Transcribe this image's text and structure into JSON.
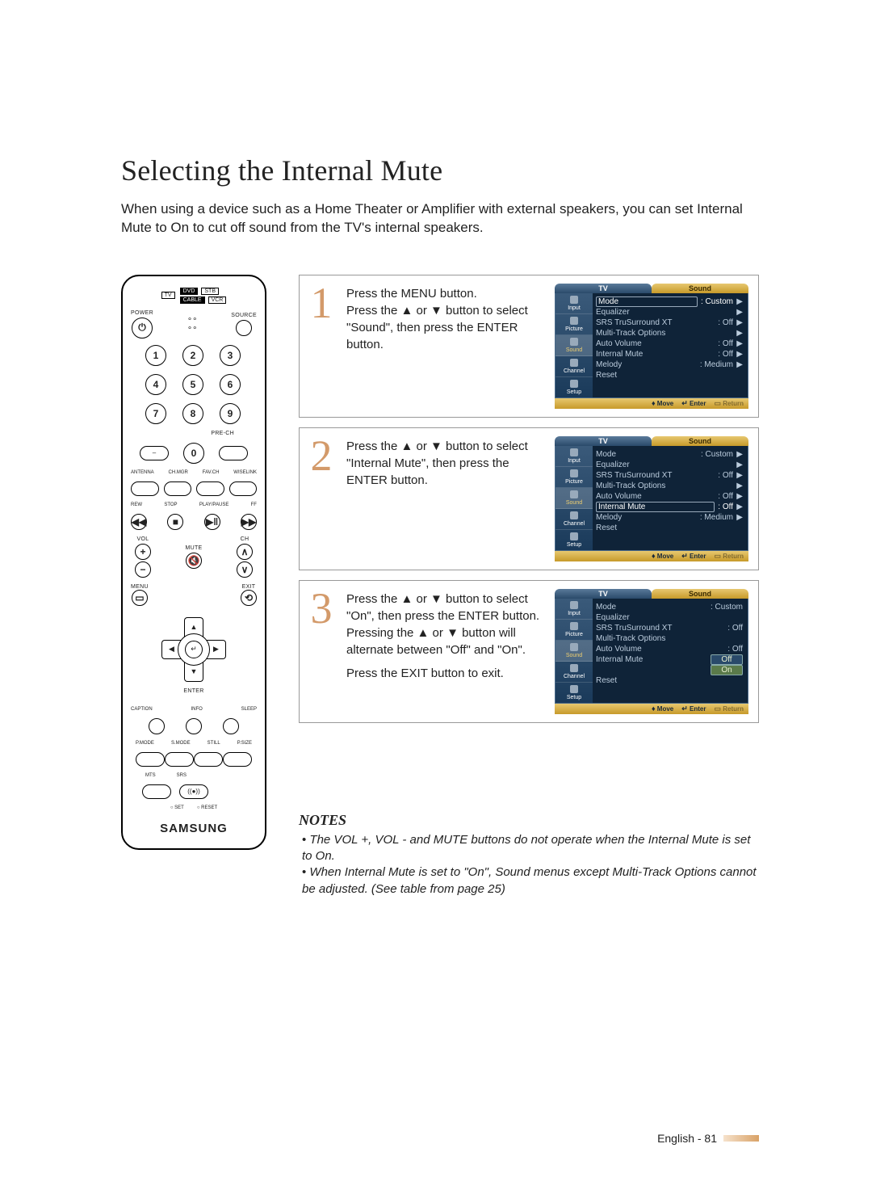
{
  "page": {
    "title": "Selecting the Internal Mute",
    "intro": "When using a device such as a Home Theater or Amplifier with external speakers, you can set Internal Mute to On to cut off sound from the TV's internal speakers.",
    "footer_lang": "English - 81"
  },
  "steps": {
    "s1": {
      "num": "1",
      "a": "Press the MENU button.",
      "b": "Press the ▲ or ▼ button to select \"Sound\", then press the ENTER button."
    },
    "s2": {
      "num": "2",
      "a": "Press the ▲ or ▼ button to select \"Internal Mute\", then press the ENTER button."
    },
    "s3": {
      "num": "3",
      "a": "Press the ▲ or ▼ button to select \"On\", then press the ENTER button.",
      "b": "Pressing the ▲ or ▼ button will alternate between \"Off\" and \"On\".",
      "c": "Press the EXIT button to exit."
    }
  },
  "notes": {
    "heading": "NOTES",
    "n1": "The VOL +, VOL - and MUTE buttons do not operate when the Internal Mute is set to On.",
    "n2": "When Internal Mute is set to \"On\", Sound menus except Multi-Track Options cannot be adjusted. (See table from page 25)"
  },
  "remote": {
    "brand": "SAMSUNG",
    "src_tv": "TV",
    "src_dvd": "DVD",
    "src_stb": "STB",
    "src_cable": "CABLE",
    "src_vcr": "VCR",
    "power": "POWER",
    "source": "SOURCE",
    "n1": "1",
    "n2": "2",
    "n3": "3",
    "n4": "4",
    "n5": "5",
    "n6": "6",
    "n7": "7",
    "n8": "8",
    "n9": "9",
    "n0": "0",
    "dash": "–",
    "prech": "PRE-CH",
    "antenna": "ANTENNA",
    "chmgr": "CH.MGR",
    "favch": "FAV.CH",
    "wiselink": "WISELINK",
    "rew": "REW",
    "stop": "STOP",
    "play": "PLAY/PAUSE",
    "ff": "FF",
    "vol": "VOL",
    "mute": "MUTE",
    "ch": "CH",
    "menu": "MENU",
    "exit": "EXIT",
    "enter": "ENTER",
    "caption": "CAPTION",
    "info": "INFO",
    "sleep": "SLEEP",
    "pmode": "P.MODE",
    "smode": "S.MODE",
    "still": "STILL",
    "psize": "P.SIZE",
    "mts": "MTS",
    "srs": "SRS",
    "set": "SET",
    "reset": "RESET"
  },
  "osd": {
    "left_tab": "TV",
    "title": "Sound",
    "side": {
      "input": "Input",
      "picture": "Picture",
      "sound": "Sound",
      "channel": "Channel",
      "setup": "Setup"
    },
    "items": {
      "mode": {
        "label": "Mode",
        "value": ": Custom"
      },
      "eq": {
        "label": "Equalizer",
        "value": ""
      },
      "srs": {
        "label": "SRS TruSurround XT",
        "value": ": Off"
      },
      "mto": {
        "label": "Multi-Track Options",
        "value": ""
      },
      "autov": {
        "label": "Auto Volume",
        "value": ": Off"
      },
      "imute": {
        "label": "Internal Mute",
        "value": ": Off"
      },
      "melody": {
        "label": "Melody",
        "value": ": Medium"
      },
      "reset": {
        "label": "Reset",
        "value": ""
      }
    },
    "opts": {
      "off": "Off",
      "on": "On"
    },
    "bottom": {
      "move": "Move",
      "enter": "Enter",
      "return": "Return"
    }
  }
}
